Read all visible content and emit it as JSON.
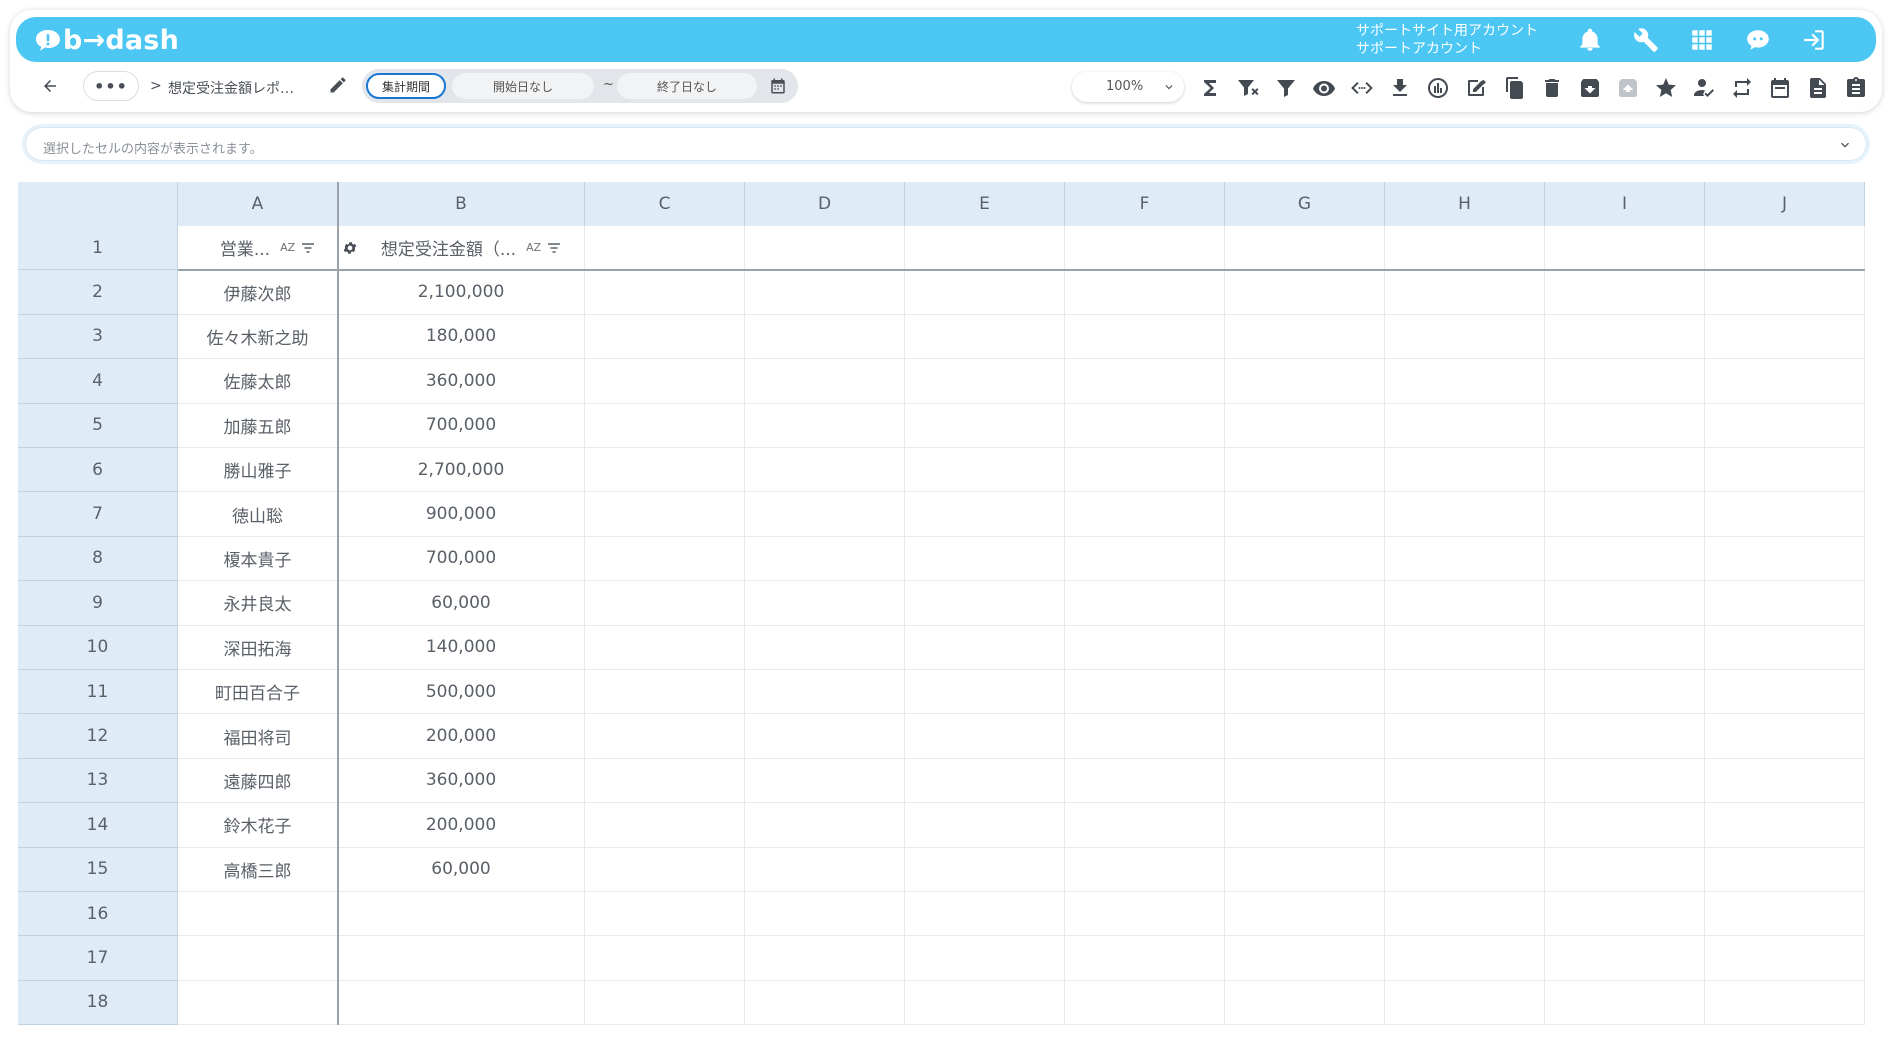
{
  "header": {
    "logo_text": "b→dash",
    "account_line1": "サポートサイト用アカウント",
    "account_line2": "サポートアカウント",
    "icons": [
      "bell-icon",
      "wrench-icon",
      "grid-icon",
      "chat-bot-icon",
      "logout-icon"
    ],
    "color": "#4cc7f4"
  },
  "toolbar": {
    "more_label": "•••",
    "breadcrumb_sep": ">",
    "report_title": "想定受注金額レポ…",
    "period_label": "集計期間",
    "start_date": "開始日なし",
    "tilde": "~",
    "end_date": "終了日なし",
    "zoom": "100%",
    "icons": [
      "sum-icon",
      "filter-clear-icon",
      "filter-icon",
      "eye-icon",
      "code-icon",
      "download-icon",
      "chart-icon",
      "edit-note-icon",
      "copy-icon",
      "trash-icon",
      "archive-icon",
      "unarchive-icon",
      "star-icon",
      "user-check-icon",
      "repeat-icon",
      "calendar-icon",
      "document-icon",
      "clipboard-icon"
    ]
  },
  "cellbar": {
    "placeholder": "選択したセルの内容が表示されます。"
  },
  "grid": {
    "columns": [
      "A",
      "B",
      "C",
      "D",
      "E",
      "F",
      "G",
      "H",
      "I",
      "J"
    ],
    "header_row": {
      "row": "1",
      "a": "営業...",
      "b": "想定受注金額（...",
      "sort_label": "AZ"
    },
    "rows": [
      {
        "row": "2",
        "a": "伊藤次郎",
        "b": "2,100,000"
      },
      {
        "row": "3",
        "a": "佐々木新之助",
        "b": "180,000"
      },
      {
        "row": "4",
        "a": "佐藤太郎",
        "b": "360,000"
      },
      {
        "row": "5",
        "a": "加藤五郎",
        "b": "700,000"
      },
      {
        "row": "6",
        "a": "勝山雅子",
        "b": "2,700,000"
      },
      {
        "row": "7",
        "a": "徳山聡",
        "b": "900,000"
      },
      {
        "row": "8",
        "a": "榎本貴子",
        "b": "700,000"
      },
      {
        "row": "9",
        "a": "永井良太",
        "b": "60,000"
      },
      {
        "row": "10",
        "a": "深田拓海",
        "b": "140,000"
      },
      {
        "row": "11",
        "a": "町田百合子",
        "b": "500,000"
      },
      {
        "row": "12",
        "a": "福田将司",
        "b": "200,000"
      },
      {
        "row": "13",
        "a": "遠藤四郎",
        "b": "360,000"
      },
      {
        "row": "14",
        "a": "鈴木花子",
        "b": "200,000"
      },
      {
        "row": "15",
        "a": "高橋三郎",
        "b": "60,000"
      },
      {
        "row": "16",
        "a": "",
        "b": ""
      },
      {
        "row": "17",
        "a": "",
        "b": ""
      },
      {
        "row": "18",
        "a": "",
        "b": ""
      }
    ]
  }
}
